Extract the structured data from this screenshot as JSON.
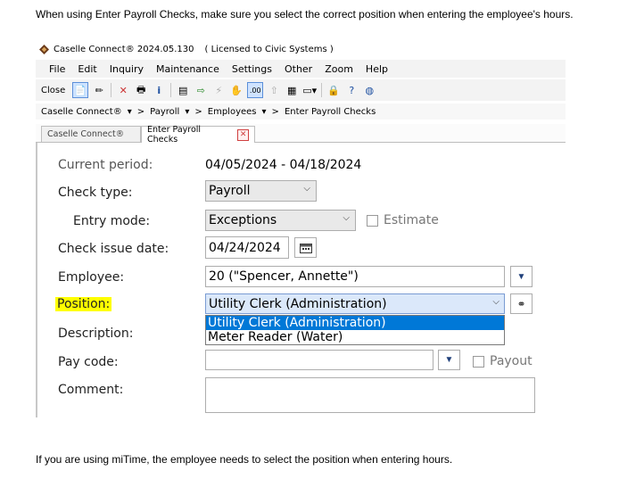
{
  "doc": {
    "intro": "When using Enter Payroll Checks, make sure you select the correct position when entering the employee's hours.",
    "outro": "If you are using miTime, the employee needs to select the position when entering hours."
  },
  "window": {
    "title": "Caselle Connect® 2024.05.130",
    "license": "( Licensed to Civic Systems )",
    "menu": [
      "File",
      "Edit",
      "Inquiry",
      "Maintenance",
      "Settings",
      "Other",
      "Zoom",
      "Help"
    ],
    "toolbar": {
      "close_label": "Close"
    },
    "breadcrumb": [
      "Caselle Connect®",
      "▾",
      ">",
      "Payroll",
      "▾",
      ">",
      "Employees",
      "▾",
      ">",
      "Enter Payroll Checks"
    ],
    "tabs": [
      {
        "label": "Caselle Connect®",
        "active": false
      },
      {
        "label": "Enter Payroll Checks",
        "active": true
      }
    ]
  },
  "form": {
    "current_period_label": "Current period:",
    "current_period_value": "04/05/2024 - 04/18/2024",
    "check_type_label": "Check type:",
    "check_type_value": "Payroll",
    "entry_mode_label": "Entry mode:",
    "entry_mode_value": "Exceptions",
    "estimate_label": "Estimate",
    "check_issue_date_label": "Check issue date:",
    "check_issue_date_value": "04/24/2024",
    "employee_label": "Employee:",
    "employee_value": "20 (\"Spencer, Annette\")",
    "position_label": "Position:",
    "position_value": "Utility Clerk (Administration)",
    "position_options": [
      "Utility Clerk (Administration)",
      "Meter Reader (Water)"
    ],
    "description_label": "Description:",
    "pay_code_label": "Pay code:",
    "payout_label": "Payout",
    "comment_label": "Comment:"
  },
  "colors": {
    "highlight": "#ffff00",
    "selected_option": "#0078d7"
  }
}
